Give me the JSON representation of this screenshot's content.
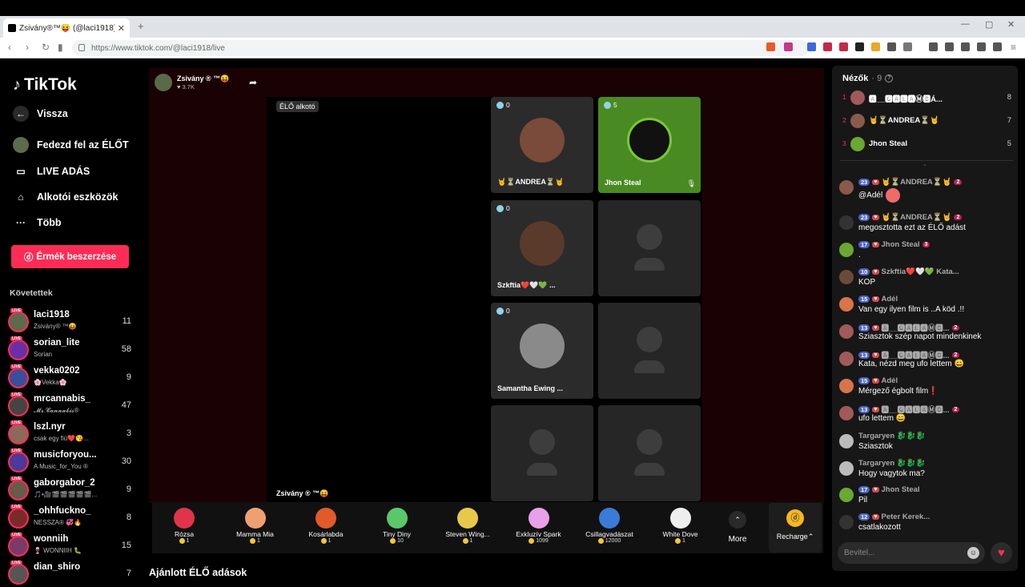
{
  "browser": {
    "tab_title": "Zsivány®™😝 (@laci1918) É…",
    "url": "https://www.tiktok.com/@laci1918/live",
    "new_tab": "+",
    "close_tab": "✕"
  },
  "sidebar": {
    "logo": "TikTok",
    "back": "Vissza",
    "nav": [
      {
        "label": "Fedezd fel az ÉLŐT",
        "icon": "explore-live-icon"
      },
      {
        "label": "LIVE ADÁS",
        "icon": "camera-icon"
      },
      {
        "label": "Alkotói eszközök",
        "icon": "house-icon"
      },
      {
        "label": "Több",
        "icon": "more-icon"
      }
    ],
    "coins_button": "Érmék beszerzése",
    "following_header": "Követettek",
    "following": [
      {
        "name": "laci1918",
        "sub": "Zsivány® ™😝",
        "count": "11",
        "color": "#5d6b4c"
      },
      {
        "name": "sorian_lite",
        "sub": "Sorian",
        "count": "58",
        "color": "#6a2fa8"
      },
      {
        "name": "vekka0202",
        "sub": "🌸Vekka🌸",
        "count": "9",
        "color": "#3b4e9a"
      },
      {
        "name": "mrcannabis_",
        "sub": "𝓜𝓻.𝓒𝓪𝓷𝓷𝓪𝓫𝓲𝓼®",
        "count": "47",
        "color": "#444"
      },
      {
        "name": "lszl.nyr",
        "sub": "csak egy fiú❤️😘...",
        "count": "3",
        "color": "#8a6a5a"
      },
      {
        "name": "musicforyou...",
        "sub": "A Music_for_You ®",
        "count": "30",
        "color": "#4a3a9a"
      },
      {
        "name": "gaborgabor_2",
        "sub": "🎵•🎥🎬🎬🎬🎬🎬...",
        "count": "9",
        "color": "#6a5a4a"
      },
      {
        "name": "_ohhfuckno_",
        "sub": "NESSZA® 💞🔥",
        "count": "8",
        "color": "#7a2a2a"
      },
      {
        "name": "wonniih",
        "sub": "🍷 WONNIIH 🐛",
        "count": "15",
        "color": "#7a3a6a"
      },
      {
        "name": "dian_shiro",
        "sub": "",
        "count": "7",
        "color": "#555"
      }
    ]
  },
  "stream": {
    "host_name": "Zsivány ® ™😝",
    "host_viewers": "♥ 3.7K",
    "badge": "ÉLŐ alkotó",
    "host_label": "Zsivány ® ™😝",
    "guests": [
      {
        "name": "🤘⏳ANDREA⏳🤘",
        "score": "0",
        "color": "#7a4a3a"
      },
      {
        "name": "Jhon Steal",
        "score": "5",
        "color": "#6aa832"
      },
      {
        "name": "Szkftia❤️🤍💚 ...",
        "score": "0",
        "color": "#5a3a2a"
      },
      {
        "name": "Samantha Ewing ...",
        "score": "0",
        "color": "#8a8a8a"
      }
    ]
  },
  "gifts": [
    {
      "name": "Rózsa",
      "price": "1",
      "color": "#e0344a"
    },
    {
      "name": "Mamma Mia",
      "price": "1",
      "color": "#f0a070"
    },
    {
      "name": "Kosárlabda",
      "price": "1",
      "color": "#e05a2a"
    },
    {
      "name": "Tiny Diny",
      "price": "10",
      "color": "#5ac86a"
    },
    {
      "name": "Steven Wing...",
      "price": "1",
      "color": "#e8c84a"
    },
    {
      "name": "Exkluzív Spark",
      "price": "1099",
      "color": "#e8a0e8"
    },
    {
      "name": "Csillagvadászat",
      "price": "12000",
      "color": "#3a7ad8"
    },
    {
      "name": "White Dove",
      "price": "1",
      "color": "#eeeeee"
    }
  ],
  "gifts_more": "More",
  "recharge": "Recharge⌃",
  "recommended": "Ajánlott ÉLŐ adások",
  "chat": {
    "header": "Nézők",
    "viewer_count": "· 9",
    "ranking": [
      {
        "rank": "1",
        "name": "🅰__🅶🅰🅻🅰Ⓜ🅱Á...",
        "points": "8",
        "color": "#a05a5a"
      },
      {
        "rank": "2",
        "name": "🤘⏳ANDREA⏳🤘",
        "points": "7",
        "color": "#8a5a4a"
      },
      {
        "rank": "3",
        "name": "Jhon Steal",
        "points": "5",
        "color": "#6aa832"
      }
    ],
    "messages": [
      {
        "name": "🤘⏳ANDREA⏳🤘",
        "level": "23",
        "sub": "2",
        "text": "@Adél",
        "color": "#8a5a4a",
        "emoji": true
      },
      {
        "name": "🤘⏳ANDREA⏳🤘",
        "level": "23",
        "sub": "2",
        "text": "megosztotta ezt az ÉLŐ adást",
        "color": "#333"
      },
      {
        "name": "Jhon Steal",
        "level": "17",
        "sub": "3",
        "text": ".",
        "color": "#6aa832"
      },
      {
        "name": "Szkftia❤️🤍💚 Kata...",
        "level": "10",
        "sub": "",
        "text": "KOP",
        "color": "#6a4a3a"
      },
      {
        "name": "Adél",
        "level": "15",
        "sub": "",
        "text": "Van egy ilyen film is ..A köd .!!",
        "color": "#d8744a"
      },
      {
        "name": "🅰__🅶🅰🅻🅰Ⓜ🅱...",
        "level": "13",
        "sub": "2",
        "text": "Sziasztok szép napot mindenkinek",
        "color": "#a05a5a"
      },
      {
        "name": "🅰__🅶🅰🅻🅰Ⓜ🅱...",
        "level": "13",
        "sub": "2",
        "text": "Kata, nézd meg ufo lettem 😄",
        "color": "#a05a5a"
      },
      {
        "name": "Adél",
        "level": "15",
        "sub": "",
        "text": "Mérgező égbolt film❗",
        "color": "#d8744a"
      },
      {
        "name": "🅰__🅶🅰🅻🅰Ⓜ🅱...",
        "level": "13",
        "sub": "2",
        "text": "ufo lettem 😄",
        "color": "#a05a5a"
      },
      {
        "name": "Targaryen 🐉🐉🐉",
        "level": "",
        "sub": "",
        "text": "Sziasztok",
        "color": "#bbb"
      },
      {
        "name": "Targaryen 🐉🐉🐉",
        "level": "",
        "sub": "",
        "text": "Hogy vagytok ma?",
        "color": "#bbb"
      },
      {
        "name": "Jhon Steal",
        "level": "17",
        "sub": "",
        "text": "Pil",
        "color": "#6aa832"
      },
      {
        "name": "Peter Kerek...",
        "level": "12",
        "sub": "",
        "text": "csatlakozott",
        "color": "#333"
      }
    ],
    "input_placeholder": "Bevitel..."
  }
}
